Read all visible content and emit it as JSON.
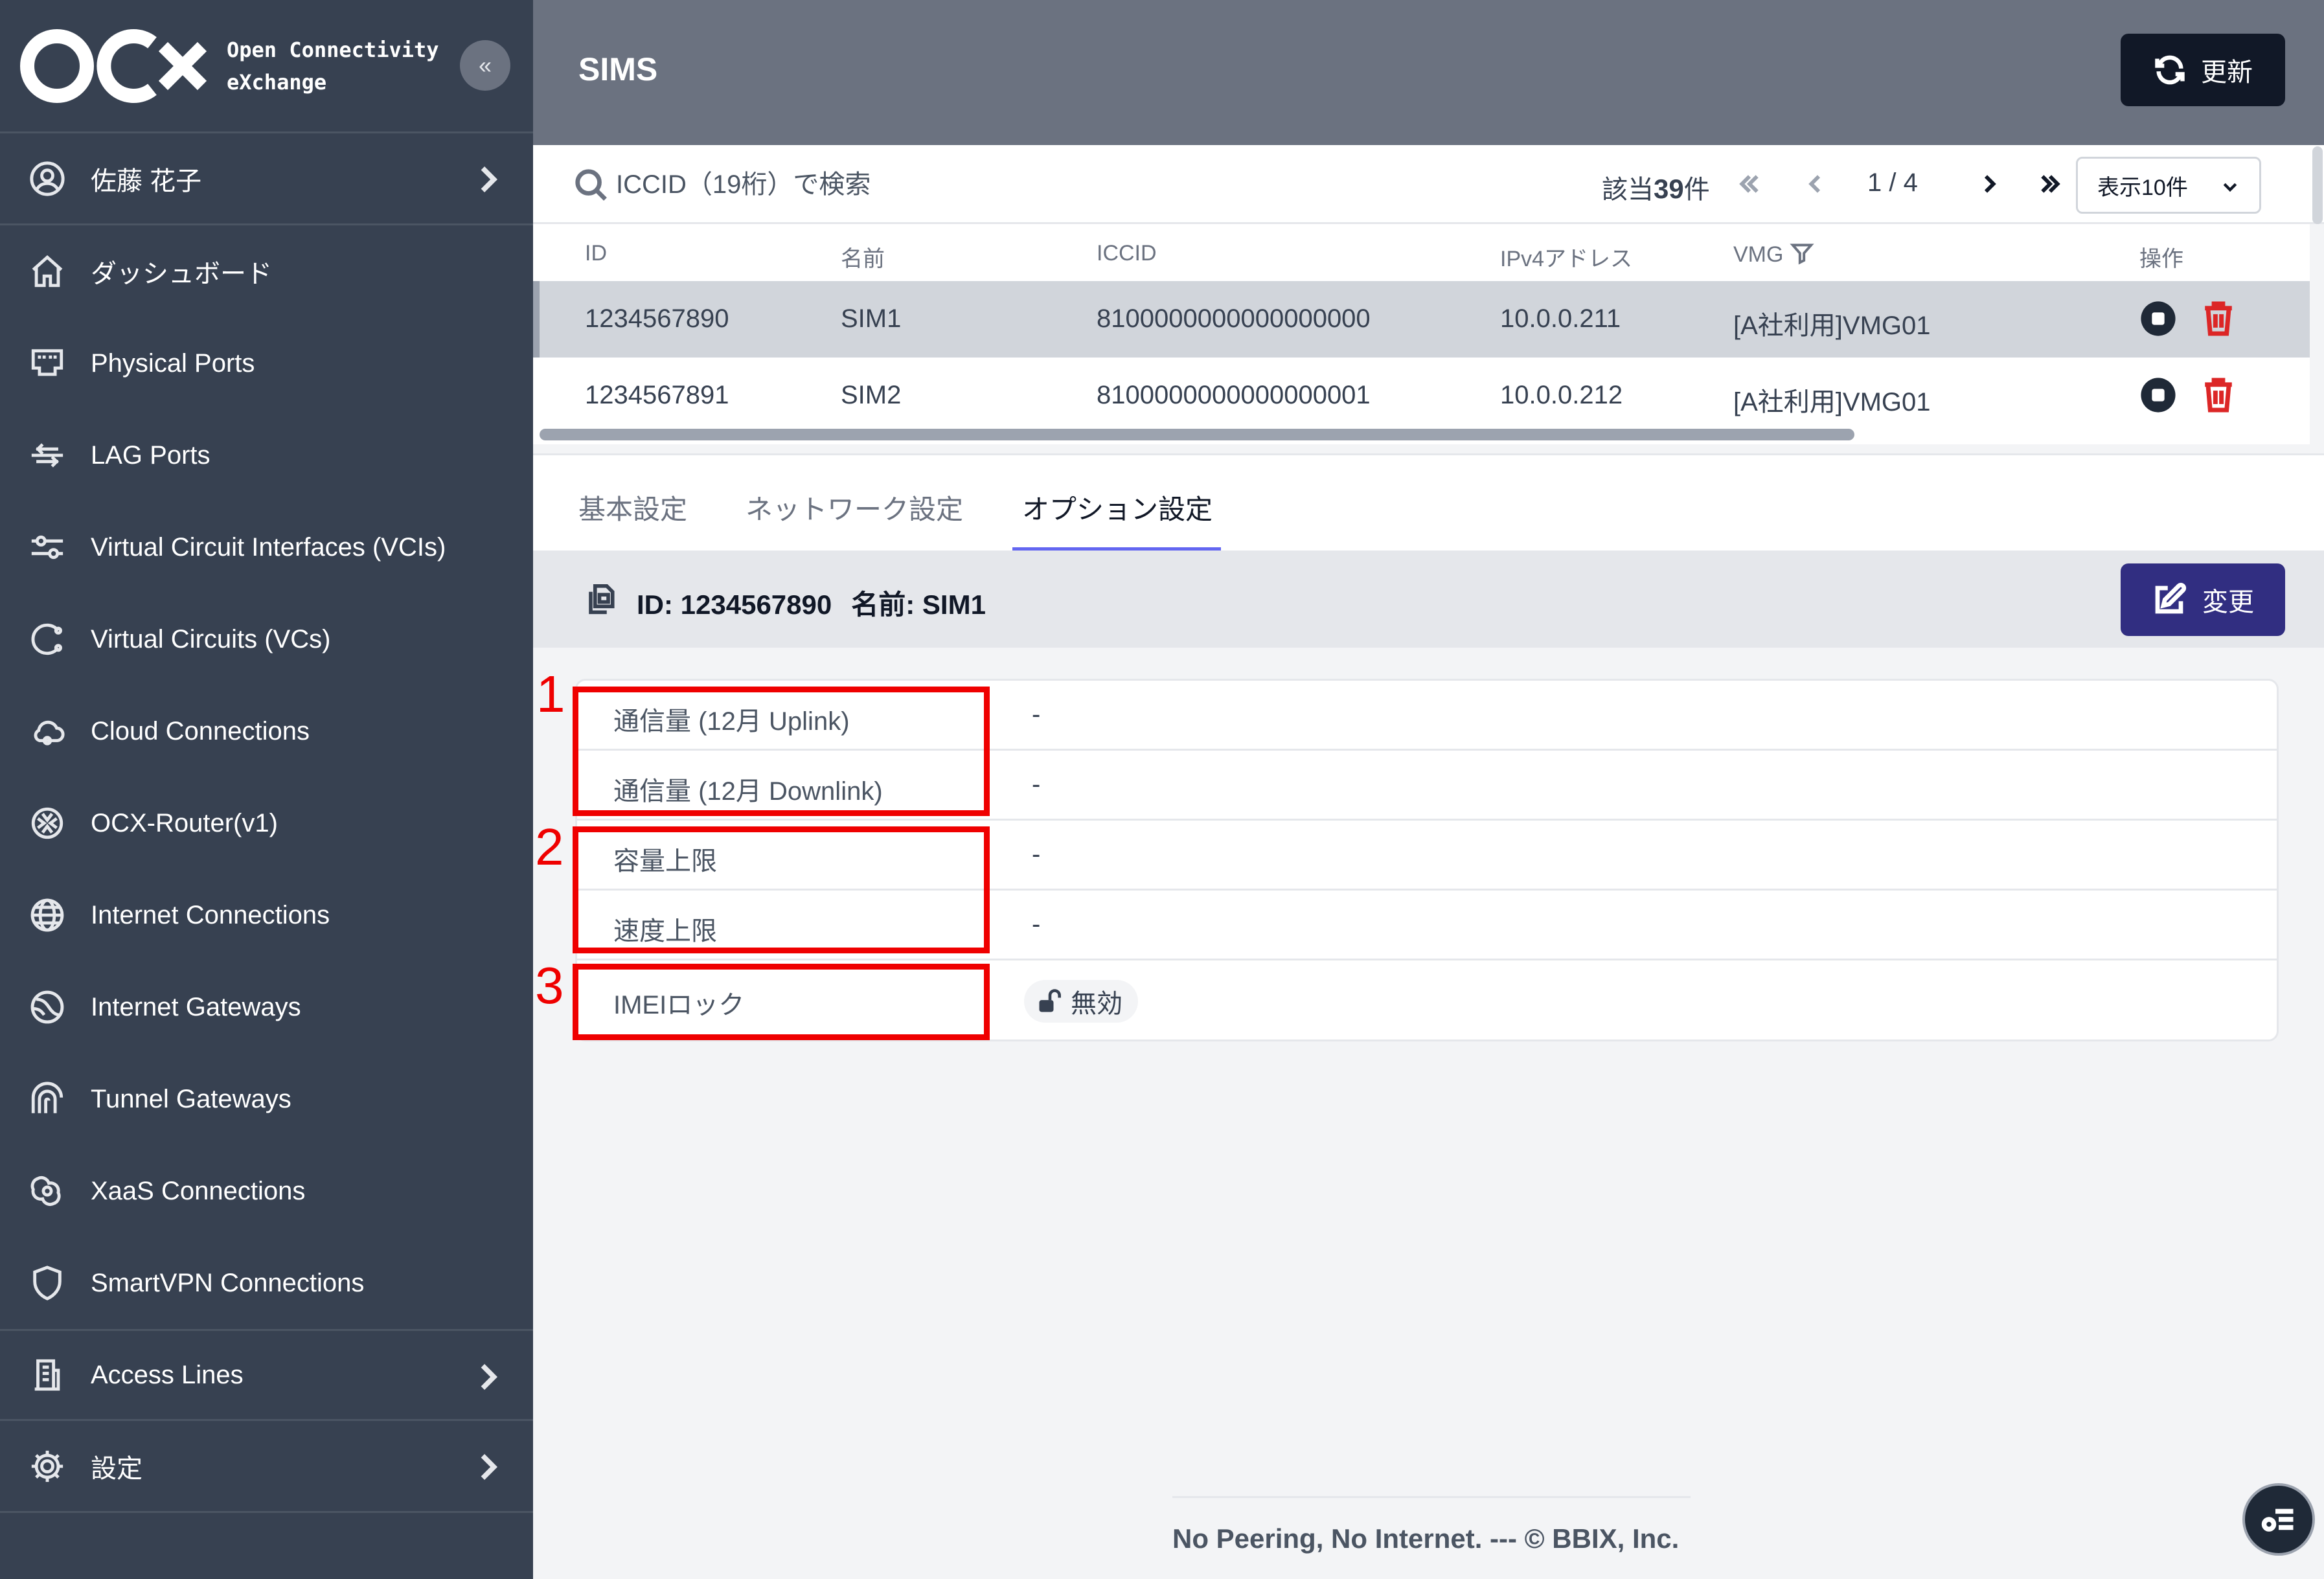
{
  "brand": {
    "line1": "Open Connectivity",
    "line2": "eXchange"
  },
  "sidebar": {
    "user": "佐藤 花子",
    "items": [
      {
        "label": "ダッシュボード",
        "icon": "home-icon"
      },
      {
        "label": "Physical Ports",
        "icon": "port-icon"
      },
      {
        "label": "LAG Ports",
        "icon": "lag-icon"
      },
      {
        "label": "Virtual Circuit Interfaces (VCIs)",
        "icon": "sliders-icon"
      },
      {
        "label": "Virtual Circuits (VCs)",
        "icon": "circuit-icon"
      },
      {
        "label": "Cloud Connections",
        "icon": "cloud-icon"
      },
      {
        "label": "OCX-Router(v1)",
        "icon": "router-icon"
      },
      {
        "label": "Internet Connections",
        "icon": "globe-icon"
      },
      {
        "label": "Internet Gateways",
        "icon": "gateway-icon"
      },
      {
        "label": "Tunnel Gateways",
        "icon": "tunnel-icon"
      },
      {
        "label": "XaaS Connections",
        "icon": "xaas-icon"
      },
      {
        "label": "SmartVPN Connections",
        "icon": "shield-icon"
      }
    ],
    "access_lines": "Access Lines",
    "settings": "設定"
  },
  "header": {
    "title": "SIMS",
    "refresh_label": "更新"
  },
  "toolbar": {
    "search_placeholder": "ICCID（19桁）で検索",
    "count_prefix": "該当",
    "count_value": "39",
    "count_suffix": "件",
    "page": "1 / 4",
    "per_page": "表示10件"
  },
  "table": {
    "headers": {
      "id": "ID",
      "name": "名前",
      "iccid": "ICCID",
      "ipv4": "IPv4アドレス",
      "vmg": "VMG",
      "ops": "操作"
    },
    "rows": [
      {
        "id": "1234567890",
        "name": "SIM1",
        "iccid": "8100000000000000000",
        "ipv4": "10.0.0.211",
        "vmg": "[A社利用]VMG01"
      },
      {
        "id": "1234567891",
        "name": "SIM2",
        "iccid": "8100000000000000001",
        "ipv4": "10.0.0.212",
        "vmg": "[A社利用]VMG01"
      }
    ]
  },
  "tabs": {
    "basic": "基本設定",
    "network": "ネットワーク設定",
    "options": "オプション設定"
  },
  "detail": {
    "id_text": "ID: 1234567890",
    "name_text": "名前: SIM1",
    "edit_label": "変更",
    "rows": [
      {
        "label": "通信量 (12月 Uplink)",
        "value": "-"
      },
      {
        "label": "通信量 (12月 Downlink)",
        "value": "-"
      },
      {
        "label": "容量上限",
        "value": "-"
      },
      {
        "label": "速度上限",
        "value": "-"
      },
      {
        "label": "IMEIロック",
        "value": "無効"
      }
    ]
  },
  "annotations": {
    "n1": "1",
    "n2": "2",
    "n3": "3"
  },
  "footer": "No Peering, No Internet. --- © BBIX, Inc.",
  "colors": {
    "sidebar": "#374151",
    "header": "#6b7280",
    "accent": "#312e81",
    "danger": "#dc2626",
    "annotation": "#ef0000"
  }
}
